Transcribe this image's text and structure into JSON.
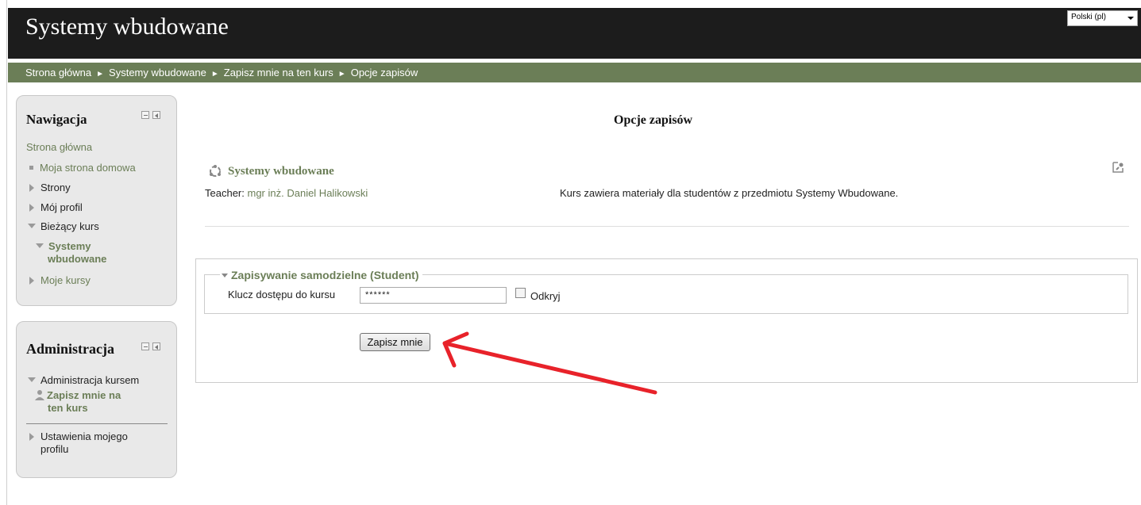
{
  "header": {
    "site_title": "Systemy wbudowane",
    "language_selected": "Polski (pl)"
  },
  "breadcrumb": {
    "items": [
      "Strona główna",
      "Systemy wbudowane",
      "Zapisz mnie na ten kurs",
      "Opcje zapisów"
    ],
    "separator": "►"
  },
  "navigation_block": {
    "title": "Nawigacja",
    "home": "Strona główna",
    "items": {
      "my_home": "Moja strona domowa",
      "pages": "Strony",
      "my_profile": "Mój profil",
      "current_course": "Bieżący kurs",
      "course_line1": "Systemy",
      "course_line2": "wbudowane",
      "my_courses": "Moje kursy"
    }
  },
  "admin_block": {
    "title": "Administracja",
    "course_admin": "Administracja kursem",
    "enrol_me_line1": "Zapisz mnie na",
    "enrol_me_line2": "ten kurs",
    "profile_settings_line1": "Ustawienia mojego",
    "profile_settings_line2": "profilu"
  },
  "main": {
    "heading": "Opcje zapisów",
    "course": {
      "name": "Systemy wbudowane",
      "teacher_label": "Teacher:",
      "teacher_name": "mgr inż. Daniel Halikowski",
      "summary": "Kurs zawiera materiały dla studentów z przedmiotu Systemy Wbudowane."
    },
    "enrol_form": {
      "legend": "Zapisywanie samodzielne (Student)",
      "key_label": "Klucz dostępu do kursu",
      "key_value": "******",
      "reveal_label": "Odkryj",
      "submit_label": "Zapisz mnie"
    }
  },
  "colors": {
    "header_bg": "#1c1c1c",
    "navbar_bg": "#6b7e57",
    "link": "#6b7e57",
    "block_bg": "#e9e9e9",
    "annotation_arrow": "#e8222a"
  },
  "icons": [
    "course-icon",
    "edit-settings-icon",
    "user-icon",
    "collapse-icon",
    "dock-icon",
    "annotation-arrow"
  ]
}
